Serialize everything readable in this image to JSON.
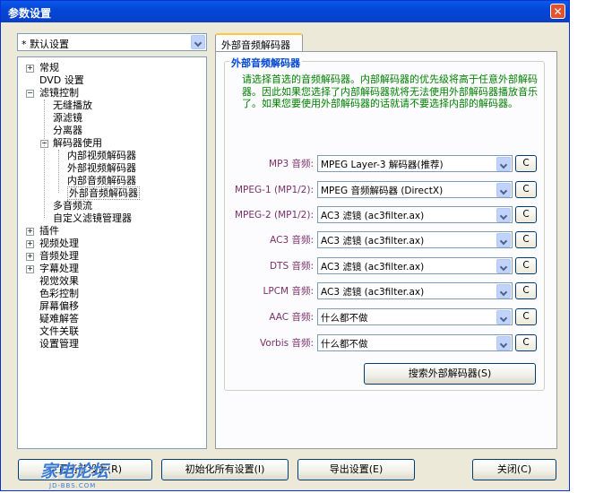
{
  "window": {
    "title": "参数设置",
    "close_glyph": "✕"
  },
  "preset": {
    "value": "* 默认设置"
  },
  "tree": {
    "items": [
      {
        "label": "常规",
        "level": 0,
        "expander": "+"
      },
      {
        "label": "DVD 设置",
        "level": 0,
        "expander": ""
      },
      {
        "label": "滤镜控制",
        "level": 0,
        "expander": "−"
      },
      {
        "label": "无缝播放",
        "level": 1,
        "expander": ""
      },
      {
        "label": "源滤镜",
        "level": 1,
        "expander": ""
      },
      {
        "label": "分离器",
        "level": 1,
        "expander": ""
      },
      {
        "label": "解码器使用",
        "level": 1,
        "expander": "−"
      },
      {
        "label": "内部视频解码器",
        "level": 2,
        "expander": ""
      },
      {
        "label": "外部视频解码器",
        "level": 2,
        "expander": ""
      },
      {
        "label": "内部音频解码器",
        "level": 2,
        "expander": ""
      },
      {
        "label": "外部音频解码器",
        "level": 2,
        "expander": "",
        "selected": true
      },
      {
        "label": "多音频流",
        "level": 1,
        "expander": ""
      },
      {
        "label": "自定义滤镜管理器",
        "level": 1,
        "expander": ""
      },
      {
        "label": "插件",
        "level": 0,
        "expander": "+"
      },
      {
        "label": "视频处理",
        "level": 0,
        "expander": "+"
      },
      {
        "label": "音频处理",
        "level": 0,
        "expander": "+"
      },
      {
        "label": "字幕处理",
        "level": 0,
        "expander": "+"
      },
      {
        "label": "视觉效果",
        "level": 0,
        "expander": ""
      },
      {
        "label": "色彩控制",
        "level": 0,
        "expander": ""
      },
      {
        "label": "屏幕偏移",
        "level": 0,
        "expander": ""
      },
      {
        "label": "疑难解答",
        "level": 0,
        "expander": ""
      },
      {
        "label": "文件关联",
        "level": 0,
        "expander": ""
      },
      {
        "label": "设置管理",
        "level": 0,
        "expander": ""
      }
    ]
  },
  "tab": {
    "label": "外部音频解码器"
  },
  "group": {
    "title": "外部音频解码器",
    "description": "请选择首选的音频解码器。内部解码器的优先级将高于任意外部解码器。因此如果您选择了内部解码器就将无法使用外部解码器播放音乐了。如果您要使用外部解码器的话就请不要选择内部的解码器。"
  },
  "decoders": [
    {
      "label": "MP3 音频:",
      "value": "MPEG Layer-3 解码器(推荐)",
      "config": "C"
    },
    {
      "label": "MPEG-1 (MP1/2):",
      "value": "MPEG 音频解码器 (DirectX)",
      "config": "C"
    },
    {
      "label": "MPEG-2 (MP1/2):",
      "value": "AC3 滤镜 (ac3filter.ax)",
      "config": "C"
    },
    {
      "label": "AC3 音频:",
      "value": "AC3 滤镜 (ac3filter.ax)",
      "config": "C"
    },
    {
      "label": "DTS 音频:",
      "value": "AC3 滤镜 (ac3filter.ax)",
      "config": "C"
    },
    {
      "label": "LPCM 音频:",
      "value": "AC3 滤镜 (ac3filter.ax)",
      "config": "C"
    },
    {
      "label": "AAC 音频:",
      "value": "什么都不做",
      "config": "C"
    },
    {
      "label": "Vorbis 音频:",
      "value": "什么都不做",
      "config": "C"
    }
  ],
  "search_button": "搜索外部解码器(S)",
  "footer": {
    "reset": "重置当前设置(R)",
    "init_all": "初始化所有设置(I)",
    "export": "导出设置(E)",
    "close": "关闭(C)"
  },
  "watermark": {
    "big": "家电论坛",
    "small": "JD-BBS.COM"
  },
  "colors": {
    "titlebar": "#0446d8",
    "label": "#7b2f6a",
    "desc": "#008000",
    "group_title": "#0046d5"
  }
}
